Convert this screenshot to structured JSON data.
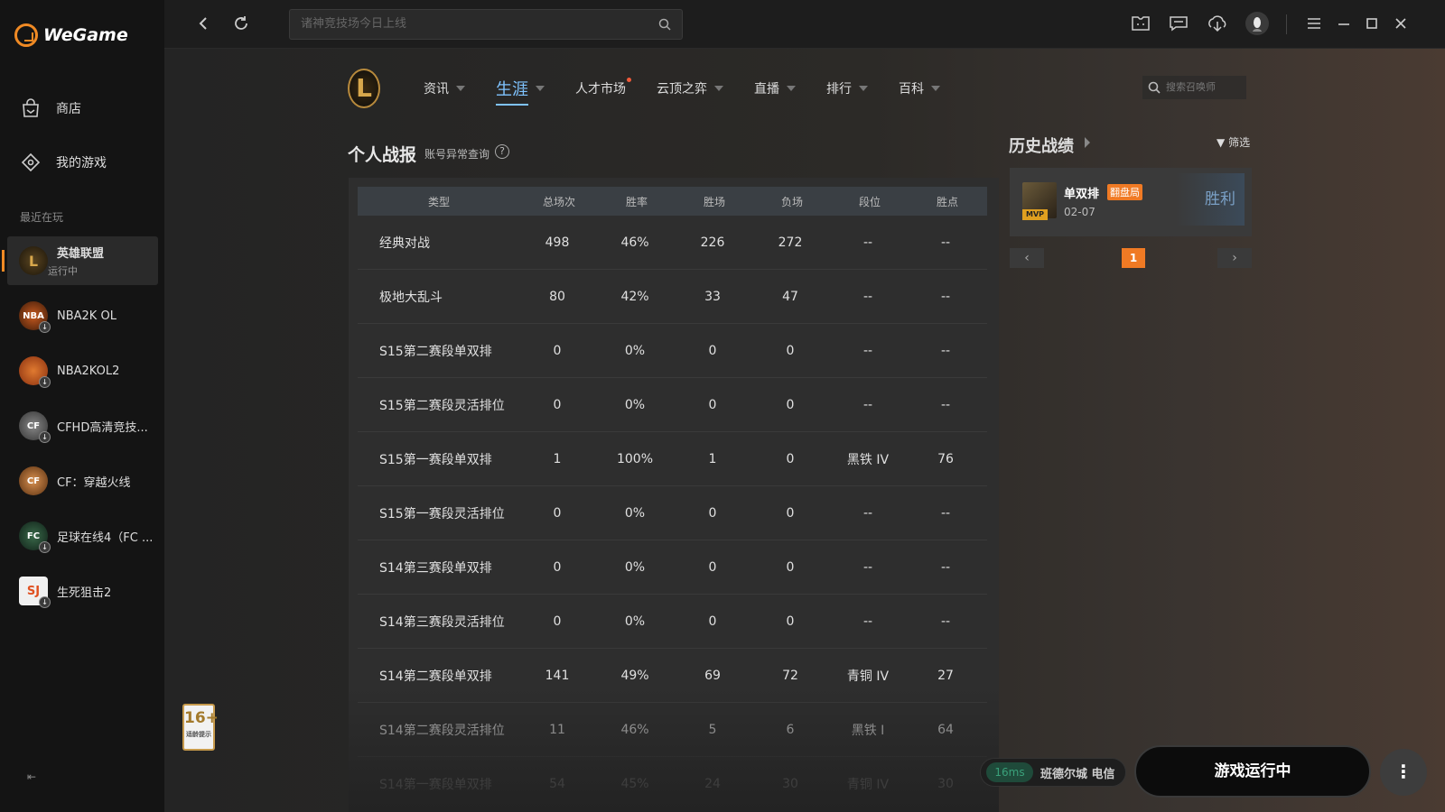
{
  "app": {
    "logo_text": "WeGame"
  },
  "sidebar": {
    "shop_label": "商店",
    "mygames_label": "我的游戏",
    "recent_label": "最近在玩",
    "games": [
      {
        "name": "英雄联盟",
        "status": "运行中"
      },
      {
        "name": "NBA2K OL"
      },
      {
        "name": "NBA2KOL2"
      },
      {
        "name": "CFHD高清竞技..."
      },
      {
        "name": "CF：穿越火线"
      },
      {
        "name": "足球在线4（FC ..."
      },
      {
        "name": "生死狙击2"
      }
    ],
    "age_rating": "16+",
    "age_note": "适龄提示"
  },
  "topbar": {
    "search_placeholder": "诸神竞技场今日上线"
  },
  "menu": {
    "logo_letter": "L",
    "items": [
      "资讯",
      "生涯",
      "人才市场",
      "云顶之弈",
      "直播",
      "排行",
      "百科"
    ],
    "active": "生涯",
    "summoner_search_placeholder": "搜索召唤师"
  },
  "stats": {
    "title": "个人战报",
    "subtitle": "账号异常查询",
    "columns": [
      "类型",
      "总场次",
      "胜率",
      "胜场",
      "负场",
      "段位",
      "胜点"
    ],
    "rows": [
      [
        "经典对战",
        "498",
        "46%",
        "226",
        "272",
        "--",
        "--"
      ],
      [
        "极地大乱斗",
        "80",
        "42%",
        "33",
        "47",
        "--",
        "--"
      ],
      [
        "S15第二赛段单双排",
        "0",
        "0%",
        "0",
        "0",
        "--",
        "--"
      ],
      [
        "S15第二赛段灵活排位",
        "0",
        "0%",
        "0",
        "0",
        "--",
        "--"
      ],
      [
        "S15第一赛段单双排",
        "1",
        "100%",
        "1",
        "0",
        "黑铁 IV",
        "76"
      ],
      [
        "S15第一赛段灵活排位",
        "0",
        "0%",
        "0",
        "0",
        "--",
        "--"
      ],
      [
        "S14第三赛段单双排",
        "0",
        "0%",
        "0",
        "0",
        "--",
        "--"
      ],
      [
        "S14第三赛段灵活排位",
        "0",
        "0%",
        "0",
        "0",
        "--",
        "--"
      ],
      [
        "S14第二赛段单双排",
        "141",
        "49%",
        "69",
        "72",
        "青铜 IV",
        "27"
      ],
      [
        "S14第二赛段灵活排位",
        "11",
        "46%",
        "5",
        "6",
        "黑铁 I",
        "64"
      ],
      [
        "S14第一赛段单双排",
        "54",
        "45%",
        "24",
        "30",
        "青铜 IV",
        "30"
      ]
    ]
  },
  "history": {
    "title": "历史战绩",
    "filter_label": "筛选",
    "match": {
      "mode": "单双排",
      "tag": "翻盘局",
      "date": "02-07",
      "result": "胜利",
      "mvp": "MVP"
    },
    "page": "1"
  },
  "footer": {
    "ping": "16ms",
    "server": "班德尔城 电信",
    "play_button": "游戏运行中",
    "more": "⋮"
  }
}
